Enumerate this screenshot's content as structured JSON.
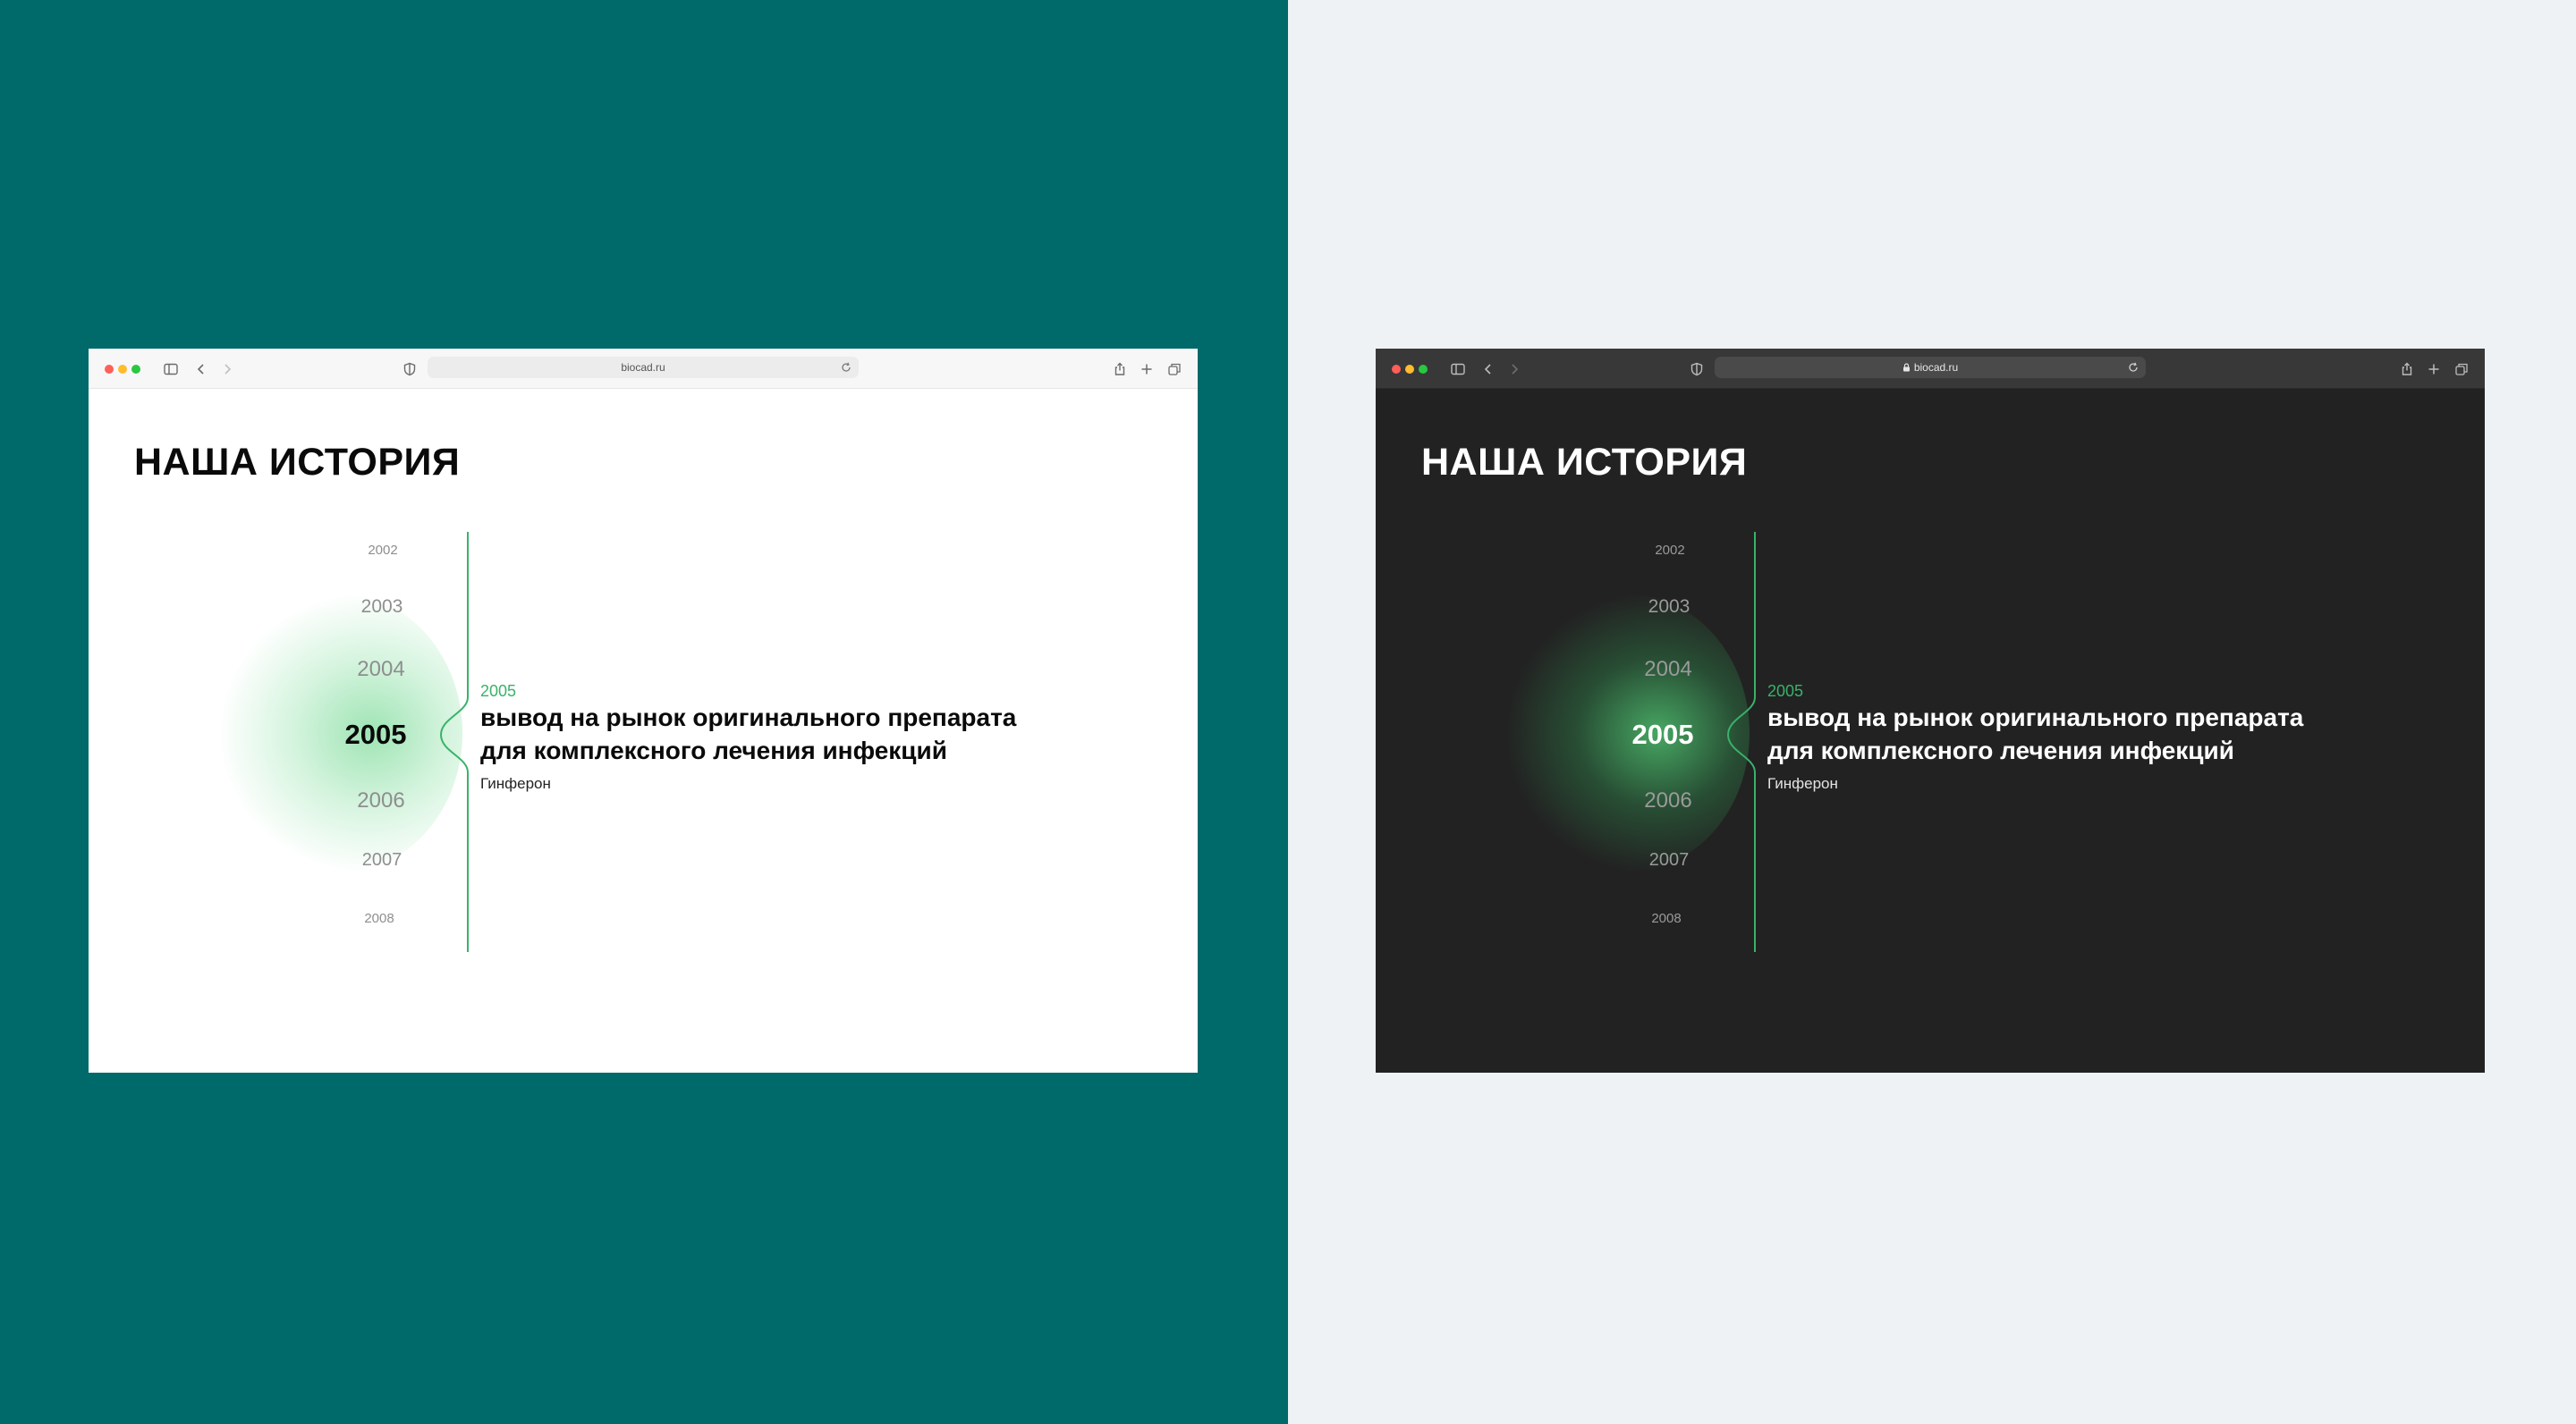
{
  "windows": [
    {
      "theme": "light",
      "url": "biocad.ru",
      "heading": "НАША ИСТОРИЯ",
      "timeline": {
        "years": [
          "2002",
          "2003",
          "2004",
          "2005",
          "2006",
          "2007",
          "2008"
        ],
        "active_year": "2005"
      },
      "event": {
        "year": "2005",
        "title_line1": "вывод на рынок оригинального препарата",
        "title_line2": "для комплексного лечения инфекций",
        "subtitle": "Гинферон"
      }
    },
    {
      "theme": "dark",
      "url": "biocad.ru",
      "heading": "НАША ИСТОРИЯ",
      "timeline": {
        "years": [
          "2002",
          "2003",
          "2004",
          "2005",
          "2006",
          "2007",
          "2008"
        ],
        "active_year": "2005"
      },
      "event": {
        "year": "2005",
        "title_line1": "вывод на рынок оригинального препарата",
        "title_line2": "для комплексного лечения инфекций",
        "subtitle": "Гинферон"
      }
    }
  ],
  "colors": {
    "left_background": "#00696a",
    "right_background": "#eef2f5",
    "accent_green": "#39b26a",
    "dark_page": "#222222"
  },
  "icons": [
    "sidebar-icon",
    "back-icon",
    "forward-icon",
    "shield-icon",
    "lock-icon",
    "reload-icon",
    "share-icon",
    "new-tab-icon",
    "tabs-icon"
  ]
}
